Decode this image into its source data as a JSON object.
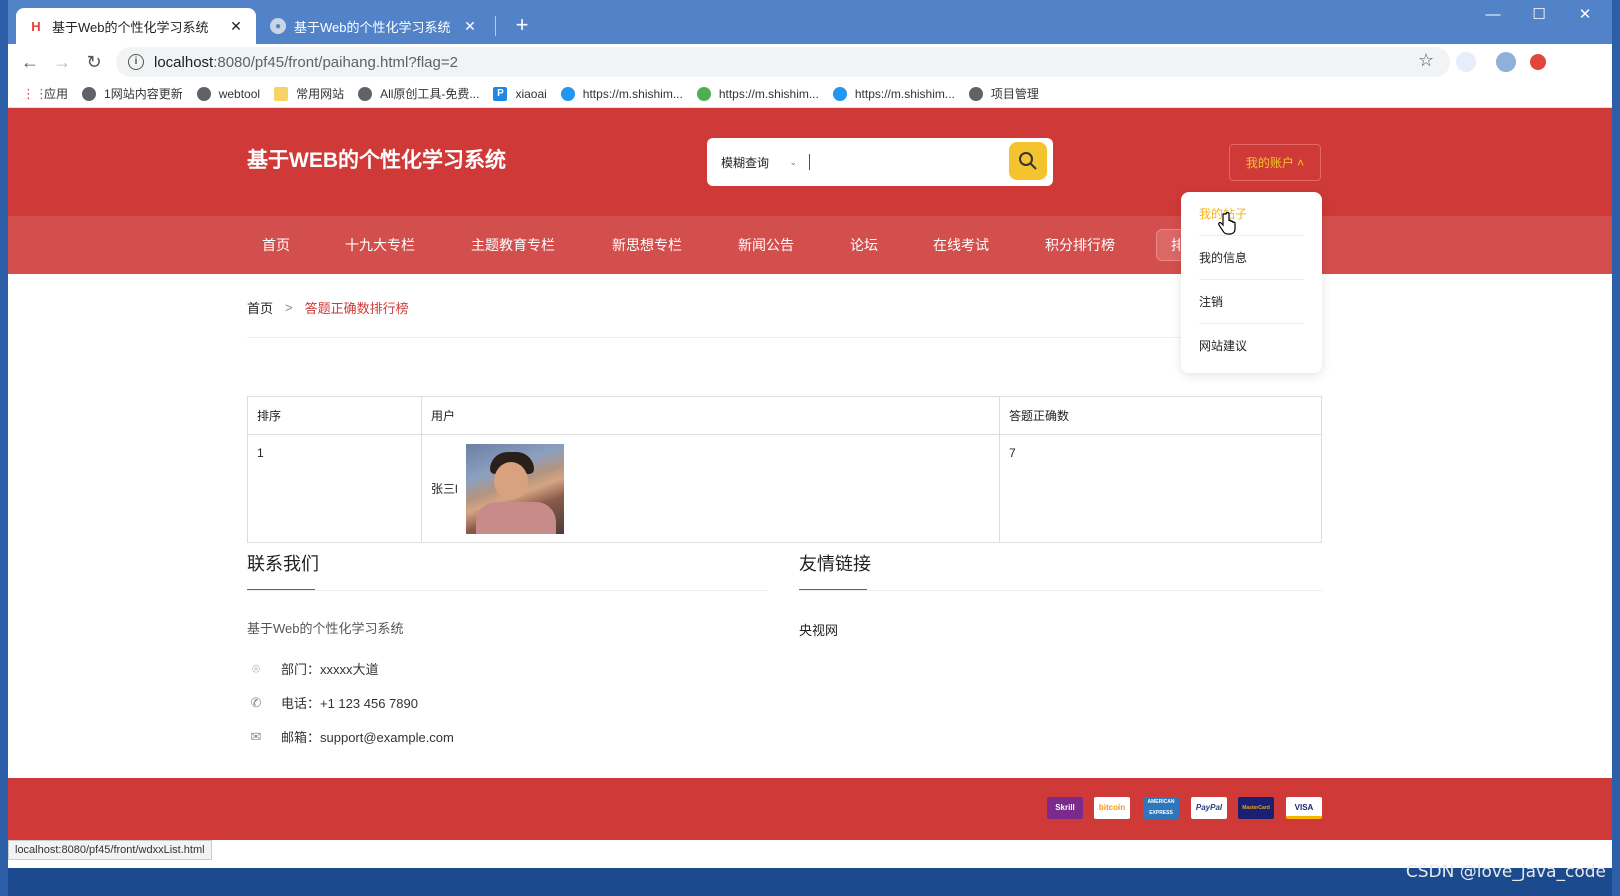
{
  "browser": {
    "tabs": [
      {
        "title": "基于Web的个性化学习系统",
        "close": "✕",
        "icon": "h-logo-icon"
      },
      {
        "title": "基于Web的个性化学习系统",
        "close": "✕",
        "icon": "globe-icon"
      }
    ],
    "new_tab": "+",
    "window_controls": [
      "—",
      "☐",
      "✕"
    ],
    "url_host": "localhost",
    "url_path": ":8080/pf45/front/paihang.html?flag=2",
    "bookmarks": [
      {
        "label": "应用",
        "icon": "apps-grid-icon"
      },
      {
        "label": "1网站内容更新",
        "icon": "globe-icon"
      },
      {
        "label": "webtool",
        "icon": "globe-icon"
      },
      {
        "label": "常用网站",
        "icon": "folder-icon"
      },
      {
        "label": "All原创工具-免费...",
        "icon": "globe-icon"
      },
      {
        "label": "xiaoai",
        "icon": "p-icon"
      },
      {
        "label": "https://m.shishim...",
        "icon": "c-icon"
      },
      {
        "label": "https://m.shishim...",
        "icon": "wechat-icon"
      },
      {
        "label": "https://m.shishim...",
        "icon": "c-icon"
      },
      {
        "label": "项目管理",
        "icon": "globe-icon"
      }
    ],
    "status_url": "localhost:8080/pf45/front/wdxxList.html"
  },
  "site": {
    "logo": "基于WEB的个性化学习系统",
    "search": {
      "select_value": "模糊查询",
      "placeholder": ""
    },
    "account_button": "我的账户 ˄",
    "nav": [
      "首页",
      "十九大专栏",
      "主题教育专栏",
      "新思想专栏",
      "新闻公告",
      "论坛",
      "在线考试",
      "积分排行榜"
    ],
    "nav_pill": "排",
    "account_menu": [
      "我的帖子",
      "我的信息",
      "注销",
      "网站建议"
    ],
    "breadcrumb": {
      "home": "首页",
      "sep": ">",
      "current": "答题正确数排行榜"
    },
    "table": {
      "headers": [
        "排序",
        "用户",
        "答题正确数"
      ],
      "rows": [
        {
          "rank": "1",
          "user": "张三l",
          "count": "7"
        }
      ]
    },
    "contact": {
      "title": "联系我们",
      "desc": "基于Web的个性化学习系统",
      "dept": "部门：xxxxx大道",
      "phone": "电话：+1 123 456 7890",
      "email": "邮箱：support@example.com"
    },
    "links": {
      "title": "友情链接",
      "items": [
        "央视网"
      ]
    },
    "payments": [
      "Skrill",
      "bitcoin",
      "AMERICAN EXPRESS",
      "PayPal",
      "MasterCard",
      "VISA"
    ]
  },
  "watermark": "CSDN @love_java_code"
}
